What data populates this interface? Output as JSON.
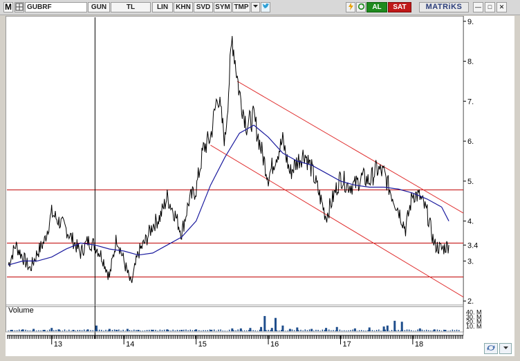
{
  "toolbar": {
    "logo": "M",
    "symbol": "GUBRF",
    "period": "GUN",
    "currency": "TL",
    "scale": "LIN",
    "khn": "KHN",
    "svd": "SVD",
    "sym": "SYM",
    "tmp": "TMP",
    "dropdown_icon": "chevron-down-icon",
    "twitter_icon": "twitter-bird-icon",
    "lightning_icon": "lightning-icon",
    "refresh_icon": "refresh-icon",
    "buy_label": "AL",
    "sell_label": "SAT",
    "brand": "MATRiKS",
    "buy_color": "#1e8a1e",
    "sell_color": "#c01818"
  },
  "window": {
    "minimize": "—",
    "restore": "□",
    "close": "✕"
  },
  "chart_data": {
    "type": "line",
    "price_axis_ticks": [
      "9.",
      "8.",
      "7.",
      "6.",
      "5.",
      "4.",
      "3.",
      "2."
    ],
    "price_axis_values": [
      9,
      8,
      7,
      6,
      5,
      4,
      3,
      2
    ],
    "ylim": [
      1.9,
      9.1
    ],
    "last_price_label": "3.4",
    "last_price": 3.4,
    "x_ticks": [
      "13",
      "14",
      "15",
      "16",
      "17",
      "18"
    ],
    "x_tick_values": [
      13,
      14,
      15,
      16,
      17,
      18
    ],
    "xlim": [
      12.38,
      18.7
    ],
    "series": [
      {
        "name": "",
        "color": "#000000",
        "x": [
          12.4,
          12.5,
          12.6,
          12.7,
          12.8,
          12.9,
          13.0,
          13.1,
          13.2,
          13.3,
          13.4,
          13.5,
          13.6,
          13.7,
          13.8,
          13.9,
          14.0,
          14.1,
          14.2,
          14.3,
          14.4,
          14.5,
          14.6,
          14.7,
          14.8,
          14.9,
          15.0,
          15.1,
          15.2,
          15.3,
          15.4,
          15.5,
          15.6,
          15.7,
          15.8,
          15.9,
          16.0,
          16.1,
          16.2,
          16.3,
          16.4,
          16.5,
          16.6,
          16.7,
          16.8,
          16.9,
          17.0,
          17.1,
          17.2,
          17.3,
          17.4,
          17.5,
          17.6,
          17.7,
          17.8,
          17.9,
          18.0,
          18.1,
          18.2,
          18.3,
          18.4,
          18.5
        ],
        "values": [
          2.9,
          3.4,
          3.1,
          2.8,
          3.2,
          3.5,
          4.2,
          4.0,
          3.8,
          3.5,
          3.2,
          3.5,
          3.4,
          3.1,
          2.6,
          3.6,
          3.0,
          2.4,
          3.2,
          3.5,
          3.9,
          4.1,
          4.6,
          4.2,
          3.7,
          4.5,
          4.8,
          5.8,
          6.1,
          7.2,
          6.0,
          8.6,
          7.2,
          6.4,
          6.6,
          5.8,
          5.1,
          5.6,
          6.0,
          5.2,
          5.5,
          5.7,
          5.3,
          4.7,
          4.1,
          4.6,
          5.1,
          4.9,
          4.9,
          5.1,
          5.0,
          5.3,
          5.2,
          4.7,
          4.3,
          3.8,
          4.7,
          4.6,
          4.2,
          3.4,
          3.3,
          3.4
        ]
      },
      {
        "name": "",
        "color": "#1a1a9e",
        "x": [
          12.4,
          12.6,
          12.8,
          13.0,
          13.2,
          13.4,
          13.6,
          13.8,
          14.0,
          14.2,
          14.4,
          14.6,
          14.8,
          15.0,
          15.2,
          15.4,
          15.6,
          15.8,
          16.0,
          16.2,
          16.4,
          16.6,
          16.8,
          17.0,
          17.2,
          17.4,
          17.6,
          17.8,
          18.0,
          18.2,
          18.4,
          18.5
        ],
        "values": [
          2.9,
          3.0,
          3.0,
          3.1,
          3.3,
          3.45,
          3.4,
          3.3,
          3.25,
          3.15,
          3.2,
          3.4,
          3.6,
          4.0,
          4.9,
          5.6,
          6.2,
          6.4,
          6.1,
          5.7,
          5.5,
          5.4,
          5.2,
          5.0,
          4.9,
          4.85,
          4.85,
          4.8,
          4.7,
          4.55,
          4.35,
          4.0
        ]
      }
    ],
    "horizontal_lines": [
      {
        "value": 4.78,
        "color": "#c00000"
      },
      {
        "value": 3.45,
        "color": "#c00000"
      },
      {
        "value": 2.6,
        "color": "#c00000"
      }
    ],
    "trend_channel": {
      "color": "#e03030",
      "upper": {
        "x": [
          15.57,
          18.7
        ],
        "y": [
          7.5,
          4.2
        ]
      },
      "lower": {
        "x": [
          15.2,
          18.7
        ],
        "y": [
          5.9,
          2.1
        ]
      }
    },
    "cursor_x": 13.6,
    "volume": {
      "label": "Volume",
      "color": "#1f4e8c",
      "axis_ticks": [
        "40. M",
        "30. M",
        "20. M",
        "10. M"
      ],
      "axis_values": [
        40,
        30,
        20,
        10
      ],
      "ylim": [
        0,
        45
      ],
      "x": [
        12.45,
        12.6,
        12.75,
        12.9,
        13.0,
        13.1,
        13.3,
        13.5,
        13.62,
        13.8,
        13.9,
        14.05,
        14.2,
        14.4,
        14.6,
        14.8,
        15.0,
        15.2,
        15.5,
        15.62,
        15.75,
        15.9,
        15.95,
        16.05,
        16.1,
        16.2,
        16.3,
        16.4,
        16.6,
        16.8,
        16.95,
        17.2,
        17.4,
        17.6,
        17.65,
        17.75,
        17.85,
        18.1,
        18.3,
        18.45
      ],
      "values": [
        3,
        4,
        5,
        3,
        7,
        4,
        3,
        4,
        12,
        5,
        3,
        5,
        3,
        3,
        4,
        3,
        4,
        3,
        6,
        6,
        7,
        9,
        32,
        7,
        28,
        12,
        5,
        8,
        5,
        7,
        9,
        6,
        8,
        10,
        12,
        22,
        20,
        6,
        4,
        3
      ]
    }
  }
}
